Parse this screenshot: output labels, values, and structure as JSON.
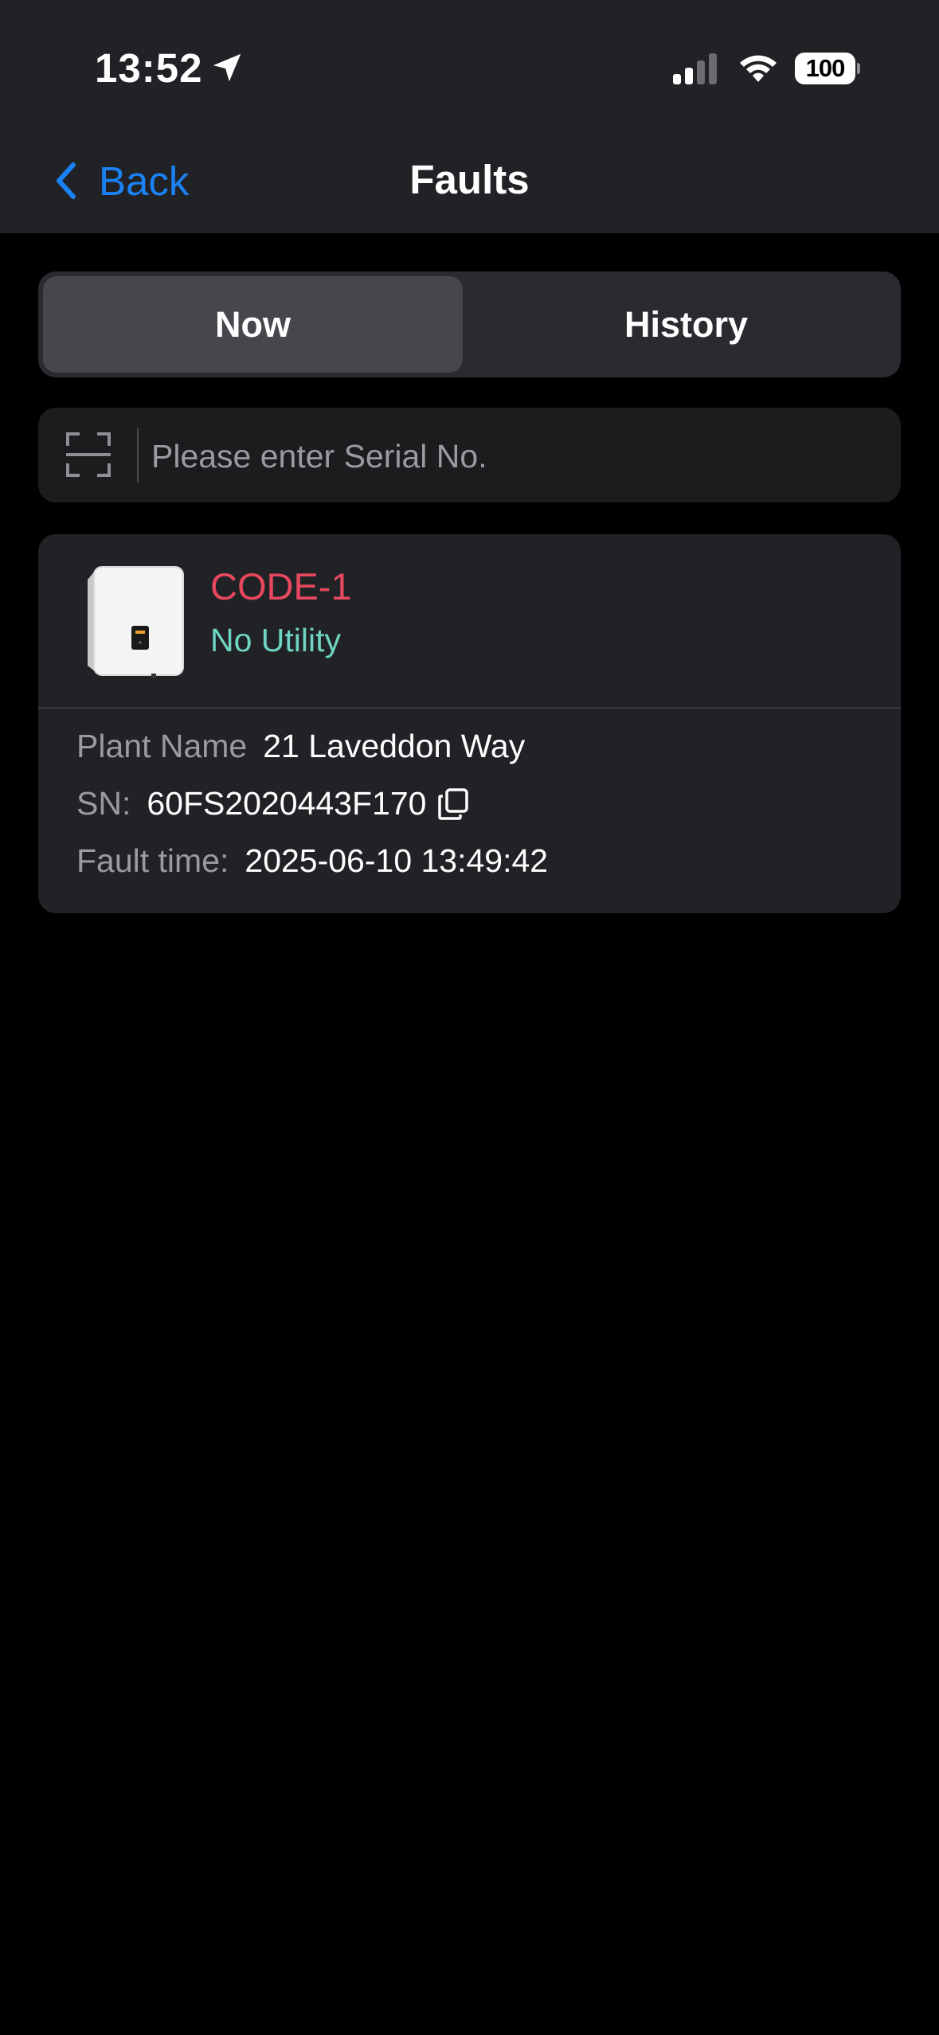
{
  "status_bar": {
    "time": "13:52",
    "battery": "100"
  },
  "nav": {
    "back_label": "Back",
    "title": "Faults"
  },
  "tabs": [
    {
      "label": "Now",
      "selected": true
    },
    {
      "label": "History",
      "selected": false
    }
  ],
  "search": {
    "placeholder": "Please enter Serial No.",
    "value": ""
  },
  "faults": [
    {
      "code": "CODE-1",
      "name": "No Utility",
      "plant_label": "Plant Name",
      "plant_name": "21 Laveddon Way",
      "sn_label": "SN:",
      "sn": "60FS2020443F170",
      "time_label": "Fault time:",
      "time": "2025-06-10 13:49:42"
    }
  ],
  "colors": {
    "header_bg": "#212226",
    "page_bg": "#000000",
    "accent_blue": "#1a82f5",
    "fault_code_red": "#e8485e",
    "fault_name_teal": "#6fd4c1"
  },
  "icons": [
    "location-arrow-icon",
    "cellular-signal-icon",
    "wifi-icon",
    "battery-icon",
    "chevron-left-icon",
    "scan-icon",
    "inverter-device-icon",
    "copy-icon"
  ]
}
